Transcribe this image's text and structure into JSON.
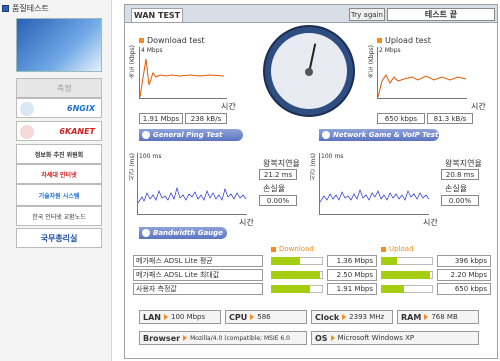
{
  "sidebar": {
    "title": "품질테스트",
    "items": [
      {
        "label": "측정",
        "color": "#999999"
      },
      {
        "label": "6NGIX",
        "color": "#1a6fd4"
      },
      {
        "label": "6KANET",
        "color": "#d11f1f"
      },
      {
        "label": "정보화 추진 위원회",
        "color": "#333333"
      },
      {
        "label": "차세대 인터넷",
        "color": "#d11f1f"
      },
      {
        "label": "기술자원 시스템",
        "color": "#1a6fd4"
      },
      {
        "label": "한국 인터넷 교환노드",
        "color": "#333333"
      },
      {
        "label": "국무총리실",
        "color": "#1a4fa4"
      }
    ]
  },
  "topbar": {
    "tab": "WAN TEST",
    "try_again": "Try again",
    "status": "테스트 끝"
  },
  "download": {
    "title": "Download test",
    "axis": "속도 (Kbps)",
    "scale": "4 Mbps",
    "time": "시간",
    "mbps": "1.91 Mbps",
    "kbs": "238 kB/s"
  },
  "upload": {
    "title": "Upload test",
    "axis": "속도 (Kbps)",
    "scale": "2 Mbps",
    "time": "시간",
    "mbps": "650 kbps",
    "kbs": "81.3 kB/s"
  },
  "ping": {
    "title": "General Ping Test",
    "axis": "시간 (ms)",
    "scale": "100 ms",
    "rtt_label": "왕복지연율",
    "rtt": "21.2 ms",
    "loss_label": "손실율",
    "loss": "0.00%",
    "time": "시간"
  },
  "game": {
    "title": "Network Game & VoIP Test",
    "axis": "시간 (ms)",
    "scale": "100 ms",
    "rtt_label": "왕복지연율",
    "rtt": "20.8 ms",
    "loss_label": "손실율",
    "loss": "0.00%",
    "time": "시간"
  },
  "bandwidth": {
    "title": "Bandwidth Gauge",
    "download_label": "Download",
    "upload_label": "Upload",
    "rows": [
      {
        "name": "메가패스 ADSL Lite 평균",
        "down": "1.36 Mbps",
        "down_fill": 0.55,
        "up": "396 kbps",
        "up_fill": 0.3
      },
      {
        "name": "메가패스 ADSL Lite 최대값",
        "down": "2.50 Mbps",
        "down_fill": 0.95,
        "up": "2.20 Mbps",
        "up_fill": 0.95
      },
      {
        "name": "사용자 측정값",
        "down": "1.91 Mbps",
        "down_fill": 0.75,
        "up": "650 kbps",
        "up_fill": 0.45
      }
    ]
  },
  "info": {
    "lan_label": "LAN",
    "lan": "100 Mbps",
    "cpu_label": "CPU",
    "cpu": "586",
    "clock_label": "Clock",
    "clock": "2393 MHz",
    "ram_label": "RAM",
    "ram": "768 MB",
    "browser_label": "Browser",
    "browser": "Mozilla/4.0 (compatible; MSIE 6.0",
    "os_label": "OS",
    "os": "Microsoft Windows XP"
  }
}
